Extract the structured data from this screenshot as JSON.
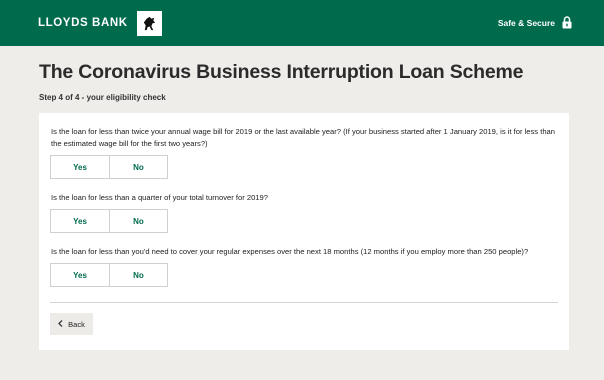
{
  "header": {
    "brand_name": "LLOYDS BANK",
    "secure_label": "Safe & Secure"
  },
  "page": {
    "title": "The Coronavirus Business Interruption Loan Scheme",
    "step": "Step 4 of 4 - your eligibility check"
  },
  "questions": [
    {
      "text": "Is the loan for less than twice your annual wage bill for 2019 or the last available year? (If your business started after 1 January 2019, is it for less than the estimated wage bill for the first two years?)",
      "yes_label": "Yes",
      "no_label": "No"
    },
    {
      "text": "Is the loan for less than a quarter of your total turnover for 2019?",
      "yes_label": "Yes",
      "no_label": "No"
    },
    {
      "text": "Is the loan for less than you'd need to cover your regular expenses over the next 18 months (12 months if you employ more than 250 people)?",
      "yes_label": "Yes",
      "no_label": "No"
    }
  ],
  "back": {
    "icon": "chevron-left-icon",
    "label": "Back"
  },
  "colors": {
    "brand_green": "#006a4d",
    "page_background": "#efedea"
  }
}
